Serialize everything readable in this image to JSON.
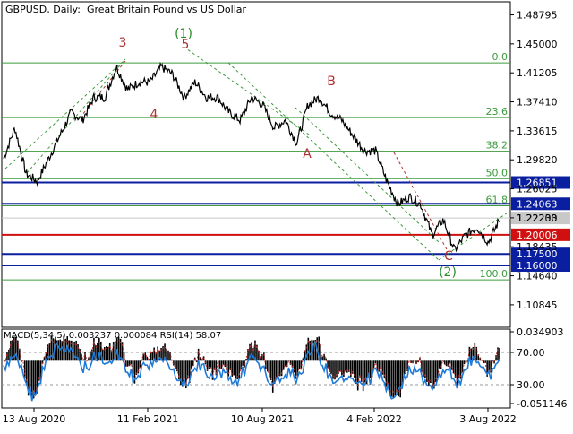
{
  "header": {
    "symbol": "GBPUSD",
    "timeframe": "Daily",
    "description": "Great Britain Pound vs US Dollar"
  },
  "indicator_header": {
    "macd_label": "MACD(5,34,5)",
    "macd_main": "0.003237",
    "macd_signal": "0.000084",
    "rsi_label": "RSI(14)",
    "rsi_value": "58.07"
  },
  "colors": {
    "background": "#ffffff",
    "price_line": "#000000",
    "grid_green": "#2e8b2e",
    "fib_green": "#3c9a3c",
    "level_blue": "#0a1ea0",
    "level_red": "#d01010",
    "wave_red": "#b03030",
    "wave_green": "#2a8a2a",
    "label_blue_bg": "#0a1ea0",
    "label_red_bg": "#d01010",
    "label_gray_bg": "#c8c8c8",
    "rsi_line": "#1e7ad6",
    "macd_hist": "#000000",
    "macd_signal": "#c03030"
  },
  "chart_data": [
    {
      "type": "line",
      "title": "GBPUSD, Daily: Great Britain Pound vs US Dollar",
      "ylim": [
        1.079,
        1.505
      ],
      "price_ticks": [
        "1.48795",
        "1.45000",
        "1.41205",
        "1.37410",
        "1.33615",
        "1.29820",
        "1.26025",
        "1.22230",
        "1.18435",
        "1.14640",
        "1.10845"
      ],
      "x_ticks": [
        "13 Aug 2020",
        "11 Feb 2021",
        "10 Aug 2021",
        "4 Feb 2022",
        "3 Aug 2022"
      ],
      "series": [
        {
          "x": [
            "13 Aug 2020",
            "11 Feb 2021",
            "10 Aug 2021",
            "4 Feb 2022",
            "3 Aug 2022"
          ],
          "values": [
            1.307,
            1.39,
            1.385,
            1.353,
            1.218
          ],
          "path": [
            1.3,
            1.34,
            1.28,
            1.27,
            1.3,
            1.33,
            1.36,
            1.35,
            1.38,
            1.38,
            1.42,
            1.39,
            1.4,
            1.4,
            1.42,
            1.41,
            1.38,
            1.4,
            1.38,
            1.38,
            1.36,
            1.35,
            1.38,
            1.37,
            1.34,
            1.35,
            1.32,
            1.37,
            1.38,
            1.36,
            1.35,
            1.33,
            1.31,
            1.31,
            1.27,
            1.24,
            1.25,
            1.24,
            1.2,
            1.22,
            1.18,
            1.2,
            1.21,
            1.19,
            1.22
          ]
        }
      ],
      "fib_levels": [
        {
          "label": "0.0",
          "value": 1.425
        },
        {
          "label": "23.6",
          "value": 1.3535
        },
        {
          "label": "38.2",
          "value": 1.3095
        },
        {
          "label": "50.0",
          "value": 1.2735
        },
        {
          "label": "61.8",
          "value": 1.238
        },
        {
          "label": "100.0",
          "value": 1.141
        }
      ],
      "levels": [
        {
          "label": "1.26851",
          "value": 1.26851,
          "color": "#0a1ea0"
        },
        {
          "label": "1.24063",
          "value": 1.24063,
          "color": "#0a1ea0"
        },
        {
          "label": "1.22203",
          "value": 1.22203,
          "color": "#c8c8c8"
        },
        {
          "label": "1.20006",
          "value": 1.20006,
          "color": "#d01010"
        },
        {
          "label": "1.17500",
          "value": 1.175,
          "color": "#0a1ea0"
        },
        {
          "label": "1.16000",
          "value": 1.16,
          "color": "#0a1ea0"
        }
      ],
      "wave_labels": [
        {
          "label": "3",
          "color": "#b03030"
        },
        {
          "label": "(1)",
          "color": "#2a8a2a"
        },
        {
          "label": "5",
          "color": "#b03030"
        },
        {
          "label": "4",
          "color": "#b03030"
        },
        {
          "label": "B",
          "color": "#b03030"
        },
        {
          "label": "A",
          "color": "#b03030"
        },
        {
          "label": "C",
          "color": "#b03030"
        },
        {
          "label": "(2)",
          "color": "#2a8a2a"
        }
      ]
    },
    {
      "type": "area",
      "title": "",
      "ylim": [
        -0.056,
        0.0375
      ],
      "ticks": [
        "0.034903",
        "70.00",
        "30.00",
        "-0.051146"
      ],
      "series": [
        {
          "name": "MACD(5,34,5)",
          "last": 0.003237
        },
        {
          "name": "RSI(14)",
          "last": 58.07
        }
      ]
    }
  ]
}
